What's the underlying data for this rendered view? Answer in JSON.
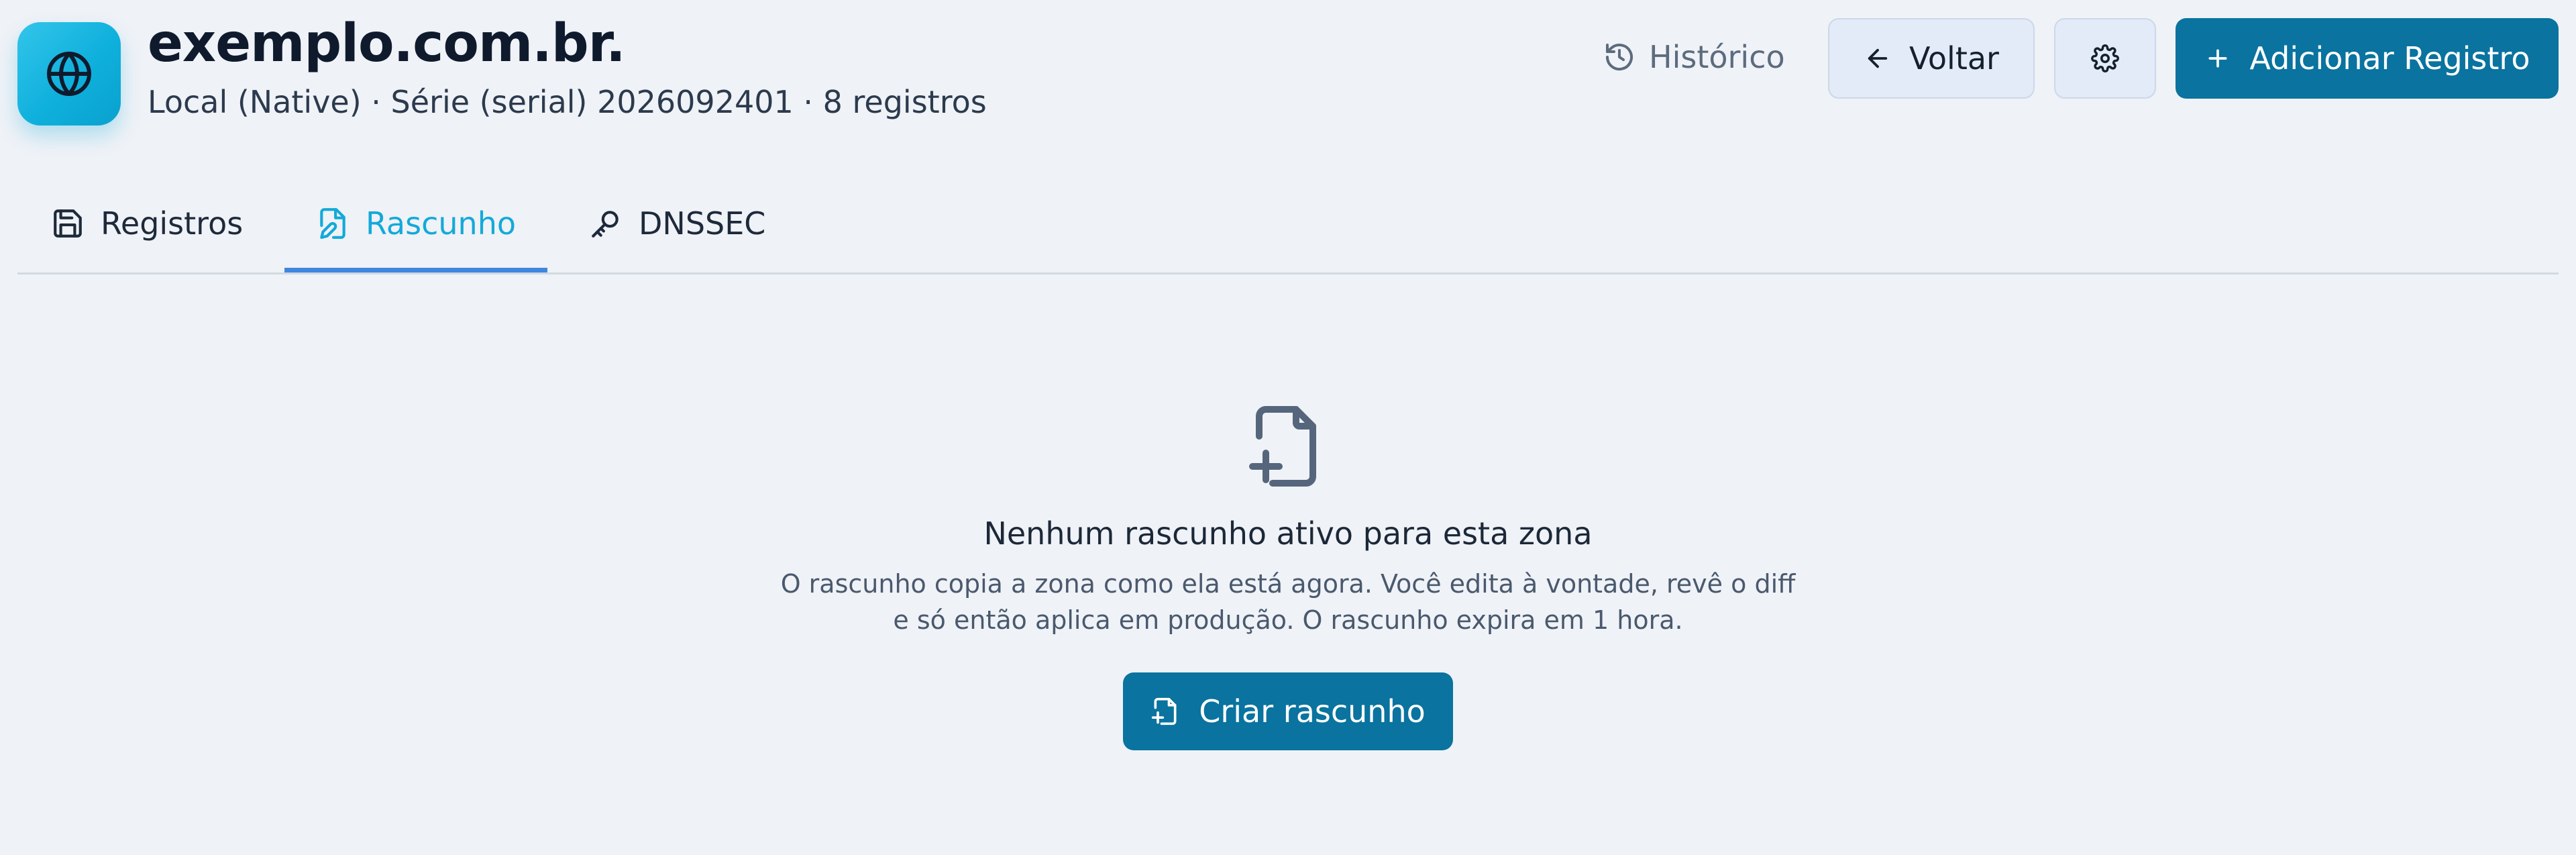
{
  "zone": {
    "title": "exemplo.com.br.",
    "subtitle": "Local (Native) · Série (serial) 2026092401 · 8 registros"
  },
  "header": {
    "history_label": "Histórico",
    "back_label": "Voltar",
    "add_label": "Adicionar Registro"
  },
  "tabs": [
    {
      "label": "Registros",
      "icon": "save-icon"
    },
    {
      "label": "Rascunho",
      "icon": "file-edit-icon",
      "active": true
    },
    {
      "label": "DNSSEC",
      "icon": "key-icon"
    }
  ],
  "empty_state": {
    "icon": "file-plus-icon",
    "title": "Nenhum rascunho ativo para esta zona",
    "description_line1": "O rascunho copia a zona como ela está agora. Você edita à vontade, revê o diff",
    "description_line2": "e só então aplica em produção. O rascunho expira em 1 hora.",
    "create_label": "Criar rascunho"
  },
  "colors": {
    "accent": "#0a739f",
    "active_tab": "#14a9d8",
    "tab_indicator": "#3f86e0",
    "background": "#eff2f7"
  }
}
